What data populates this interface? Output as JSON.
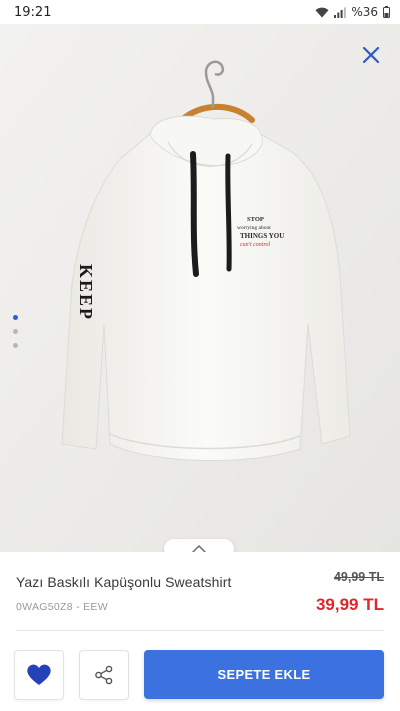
{
  "status_bar": {
    "time": "19:21",
    "battery": "%36",
    "icons": [
      "wifi-icon",
      "signal-icon",
      "battery-icon"
    ]
  },
  "gallery": {
    "active_dot": 0,
    "dot_count": 3,
    "icons": [
      "close-icon",
      "chevron-up-icon"
    ],
    "print_text": {
      "line1": "STOP",
      "line2": "worrying about",
      "line3": "THINGS YOU",
      "line4": "can't control",
      "sleeve": "KEEP"
    }
  },
  "product": {
    "title": "Yazı Baskılı Kapüşonlu Sweatshirt",
    "code": "0WAG50Z8 - EEW",
    "old_price": "49,99 TL",
    "new_price": "39,99 TL"
  },
  "actions": {
    "add_to_cart_label": "SEPETE EKLE",
    "icons": [
      "heart-icon",
      "share-icon"
    ]
  },
  "colors": {
    "accent": "#3b72e0",
    "price_red": "#e0262d",
    "dot_active": "#2d5fd6"
  }
}
